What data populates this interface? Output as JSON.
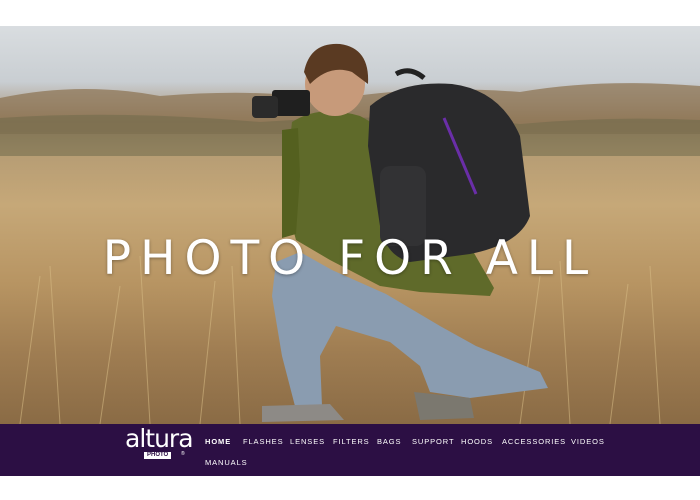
{
  "hero": {
    "title": "PHOTO FOR ALL"
  },
  "logo": {
    "word": "altura",
    "sub": "PHOTO",
    "reg": "®"
  },
  "nav": {
    "items": [
      {
        "label": "HOME",
        "active": true
      },
      {
        "label": "FLASHES"
      },
      {
        "label": "LENSES"
      },
      {
        "label": "FILTERS"
      },
      {
        "label": "BAGS"
      },
      {
        "label": "SUPPORT"
      },
      {
        "label": "HOODS"
      },
      {
        "label": "ACCESSORIES"
      },
      {
        "label": "VIDEOS"
      },
      {
        "label": "MANUALS"
      }
    ]
  },
  "colors": {
    "navbar_bg": "#2c0f44",
    "text": "#ffffff"
  }
}
